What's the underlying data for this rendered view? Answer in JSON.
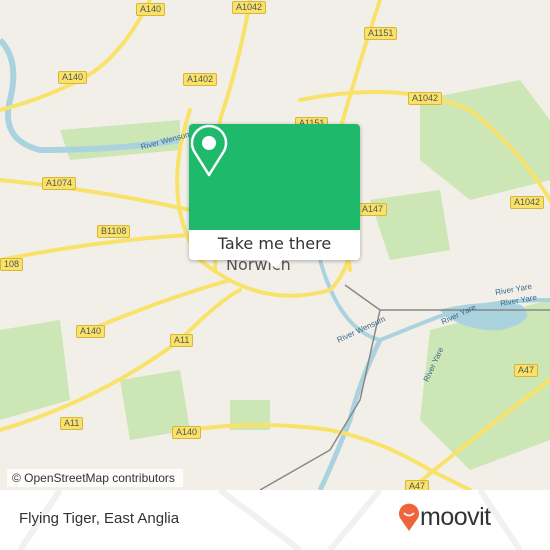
{
  "map": {
    "place_label": "Norwich",
    "road_labels": [
      "A140",
      "A1042",
      "A1151",
      "A140",
      "A1402",
      "A1042",
      "A1151",
      "A1074",
      "A147",
      "A1042",
      "B1108",
      "108",
      "A140",
      "A11",
      "A11",
      "A140",
      "A47",
      "A47"
    ],
    "water_labels": [
      "River Wensum",
      "River Wensum",
      "River Yare",
      "River Yare",
      "River Yare",
      "River Yare"
    ],
    "attribution": "© OpenStreetMap contributors",
    "colors": {
      "land": "#f2efe9",
      "park": "#cde6b5",
      "water": "#aad3df",
      "road": "#f9e26a"
    }
  },
  "popup": {
    "button_label": "Take me there",
    "color": "#1fb96c",
    "icon": "map-pin-icon"
  },
  "footer": {
    "title": "Flying Tiger, East Anglia",
    "brand": "moovit",
    "brand_color": "#f0643c"
  }
}
